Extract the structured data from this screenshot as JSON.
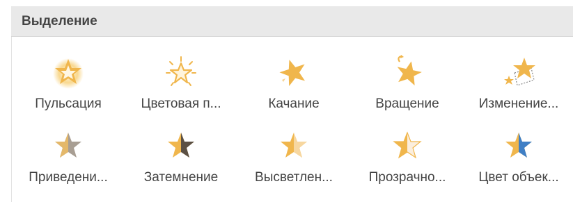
{
  "section": {
    "title": "Выделение"
  },
  "effects": [
    {
      "label": "Пульсация",
      "icon": "pulse-star-icon"
    },
    {
      "label": "Цветовая п...",
      "icon": "color-pulse-star-icon"
    },
    {
      "label": "Качание",
      "icon": "teeter-star-icon"
    },
    {
      "label": "Вращение",
      "icon": "spin-star-icon"
    },
    {
      "label": "Изменение...",
      "icon": "grow-shrink-star-icon"
    },
    {
      "label": "Приведени...",
      "icon": "desaturate-star-icon"
    },
    {
      "label": "Затемнение",
      "icon": "darken-star-icon"
    },
    {
      "label": "Высветлен...",
      "icon": "lighten-star-icon"
    },
    {
      "label": "Прозрачно...",
      "icon": "transparency-star-icon"
    },
    {
      "label": "Цвет объек...",
      "icon": "object-color-star-icon"
    }
  ],
  "colors": {
    "star_gold": "#f0b64c",
    "star_light": "#f7d7a0",
    "star_dark": "#5b5044",
    "star_gray": "#a89e93",
    "star_blue": "#3f7fc5",
    "text": "#444444",
    "header_bg": "#e9e9e9"
  }
}
